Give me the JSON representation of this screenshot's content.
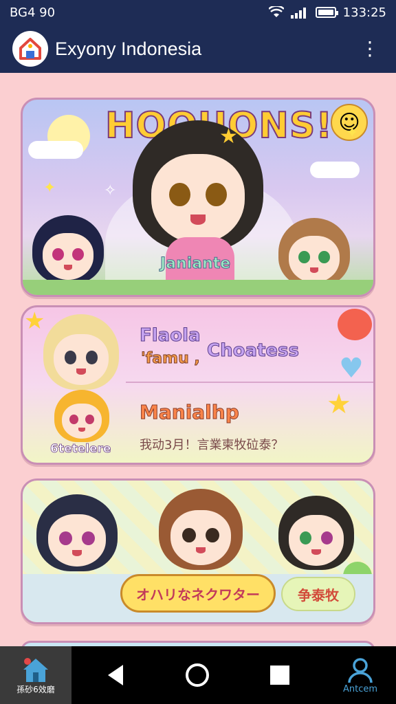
{
  "status": {
    "left": "BG4 90",
    "time": "133:25"
  },
  "app": {
    "title": "Exyony Indonesia",
    "menu_icon": "more-vert-icon",
    "logo_icon": "house-logo-icon"
  },
  "banner": {
    "title": "HOQUONS!",
    "name_tag": "Janiante"
  },
  "card2": {
    "tag1": "Flaola",
    "tag2": "'famu ,",
    "tag3": "Choatess",
    "heading": "Manialhp",
    "subtitle": "我动3月！言業柬牧砬泰？",
    "char_label": "6tetelere"
  },
  "card3": {
    "primary_button": "オハリなネクワター",
    "secondary_button": "争泰牧"
  },
  "nav": {
    "home_label": "孫砂6效磨",
    "profile_label": "Antcem"
  },
  "colors": {
    "bar": "#1e2c55",
    "page": "#fbcfd1",
    "accent_yellow": "#ffd84d",
    "card_border": "#c98fb5"
  }
}
